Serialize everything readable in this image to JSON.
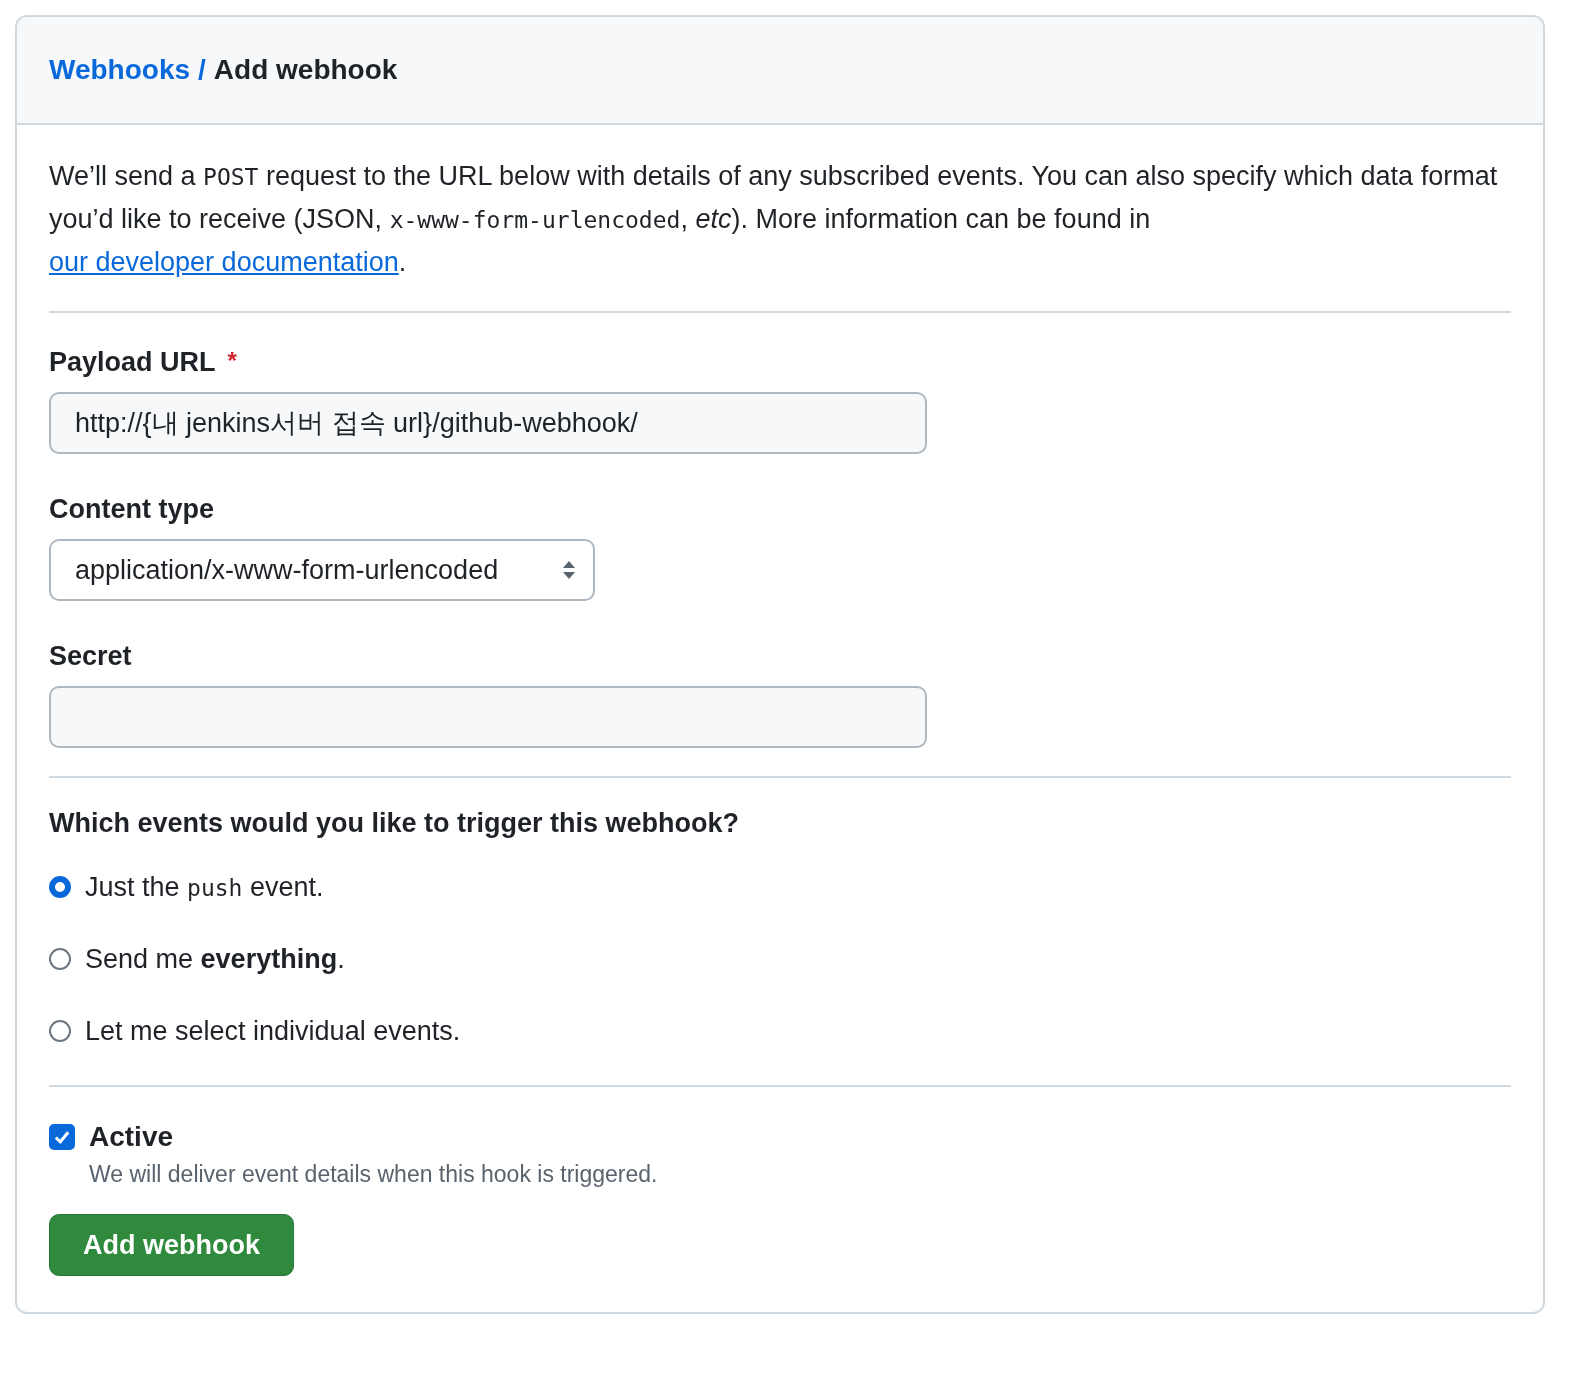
{
  "header": {
    "breadcrumb_link": "Webhooks",
    "separator": "/",
    "title": "Add webhook"
  },
  "intro": [
    {
      "kind": "text",
      "text": "We’ll send a "
    },
    {
      "kind": "code",
      "text": "POST"
    },
    {
      "kind": "text",
      "text": " request to the URL below with details of any subscribed events. You can also specify which data format you’d like to receive (JSON, "
    },
    {
      "kind": "code",
      "text": "x-www-form-urlencoded"
    },
    {
      "kind": "text",
      "text": ", "
    },
    {
      "kind": "em",
      "text": "etc"
    },
    {
      "kind": "text",
      "text": "). More information can be found in "
    },
    {
      "kind": "link",
      "text": "our developer documentation"
    },
    {
      "kind": "text",
      "text": "."
    }
  ],
  "payload_url": {
    "label": "Payload URL",
    "required_mark": "*",
    "value": "http://{내 jenkins서버 접속 url}/github-webhook/"
  },
  "content_type": {
    "label": "Content type",
    "value": "application/x-www-form-urlencoded"
  },
  "secret": {
    "label": "Secret"
  },
  "events": {
    "question": "Which events would you like to trigger this webhook?",
    "options": [
      {
        "selected": true,
        "parts": [
          {
            "kind": "text",
            "text": "Just the "
          },
          {
            "kind": "code",
            "text": "push"
          },
          {
            "kind": "text",
            "text": " event."
          }
        ]
      },
      {
        "selected": false,
        "parts": [
          {
            "kind": "text",
            "text": "Send me "
          },
          {
            "kind": "bold",
            "text": "everything"
          },
          {
            "kind": "text",
            "text": "."
          }
        ]
      },
      {
        "selected": false,
        "parts": [
          {
            "kind": "text",
            "text": "Let me select individual events."
          }
        ]
      }
    ]
  },
  "active": {
    "label": "Active",
    "checked": true,
    "note": "We will deliver event details when this hook is triggered."
  },
  "submit": "Add webhook"
}
